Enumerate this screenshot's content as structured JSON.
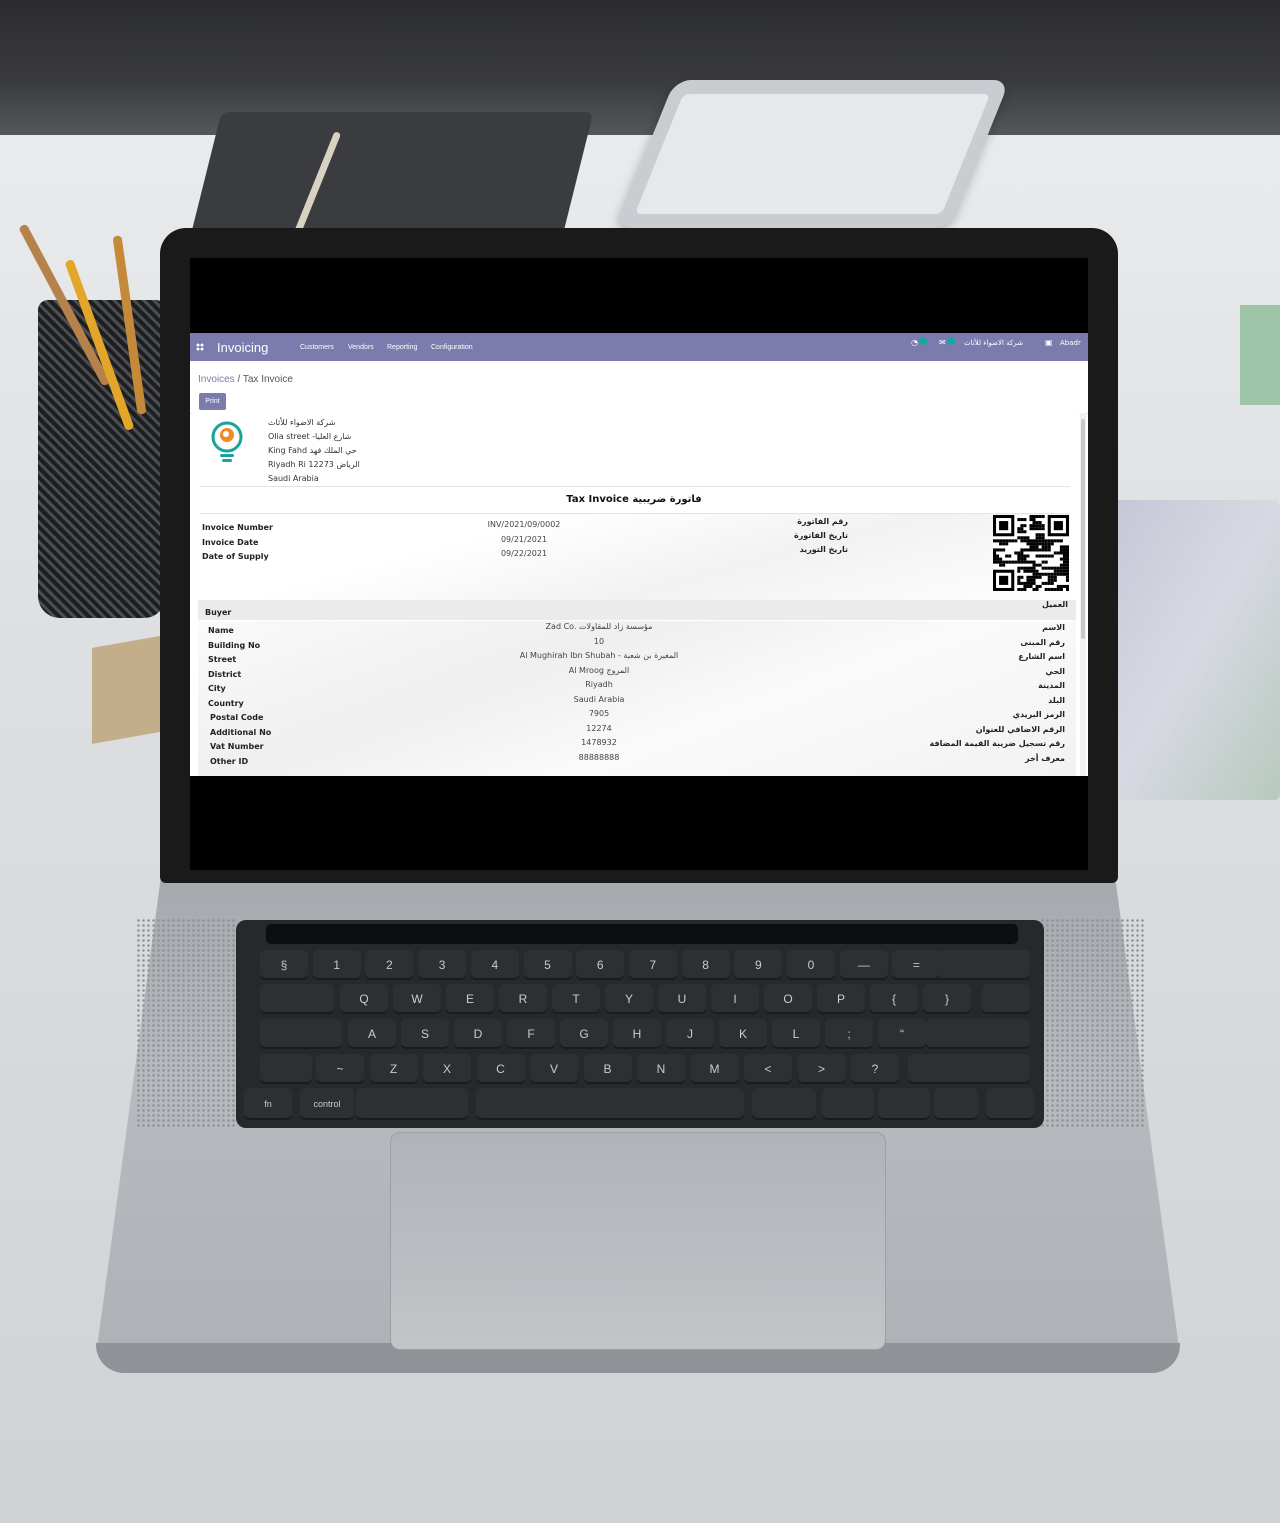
{
  "navbar": {
    "app_title": "Invoicing",
    "menu": [
      "Customers",
      "Vendors",
      "Reporting",
      "Configuration"
    ],
    "activity_count": "17",
    "messages_count": "6",
    "company": "شركة الاضواء للأثاث",
    "user": "Abadr"
  },
  "breadcrumb": {
    "parent": "Invoices",
    "separator": "/",
    "current": "Tax Invoice"
  },
  "print_label": "Print",
  "company": {
    "lines": [
      "شركة الاضواء للأثاث",
      "Olia street -شارع العليا",
      "King Fahd حي الملك فهد",
      "Riyadh Ri 12273 الرياض",
      "Saudi Arabia"
    ]
  },
  "invoice": {
    "title": "Tax Invoice فاتورة ضريبية",
    "fields": [
      {
        "label": "Invoice Number",
        "value": "INV/2021/09/0002",
        "label_ar": "رقم الفاتورة"
      },
      {
        "label": "Invoice Date",
        "value": "09/21/2021",
        "label_ar": "تاريخ الفاتورة"
      },
      {
        "label": "Date of Supply",
        "value": "09/22/2021",
        "label_ar": "تاريخ التوريد"
      }
    ]
  },
  "buyer": {
    "heading": "Buyer",
    "heading_ar": "العميل",
    "fields": [
      {
        "label": "Name",
        "value": "Zad Co. مؤسسة زاد للمقاولات",
        "label_ar": "الاسم"
      },
      {
        "label": "Building No",
        "value": "10",
        "label_ar": "رقم المبنى"
      },
      {
        "label": "Street",
        "value": "Al Mughirah Ibn Shubah - المغيرة بن شعبة",
        "label_ar": "اسم الشارع"
      },
      {
        "label": "District",
        "value": "Al Mroog المروج",
        "label_ar": "الحي"
      },
      {
        "label": "City",
        "value": "Riyadh",
        "label_ar": "المدينة"
      },
      {
        "label": "Country",
        "value": "Saudi Arabia",
        "label_ar": "البلد"
      },
      {
        "label": "Postal Code",
        "value": "7905",
        "label_ar": "الرمز البريدي"
      },
      {
        "label": "Additional No",
        "value": "12274",
        "label_ar": "الرقم الاضافي للعنوان"
      },
      {
        "label": "Vat Number",
        "value": "1478932",
        "label_ar": "رقم تسجيل ضريبة القيمة المضافة"
      },
      {
        "label": "Other ID",
        "value": "88888888",
        "label_ar": "معرف أخر"
      }
    ]
  },
  "colors": {
    "navbar": "#7c7bad",
    "accent_badge": "#16a6a0",
    "logo_teal": "#1aa39a",
    "logo_orange": "#f08a24"
  },
  "icons": [
    "apps-icon",
    "activity-icon",
    "chat-icon",
    "company-switch-icon",
    "company-logo-icon",
    "qr-code-icon"
  ],
  "keyboard": {
    "row1": [
      "§",
      "1",
      "2",
      "3",
      "4",
      "5",
      "6",
      "7",
      "8",
      "9",
      "0",
      "—",
      "="
    ],
    "row2": [
      "Q",
      "W",
      "E",
      "R",
      "T",
      "Y",
      "U",
      "I",
      "O",
      "P",
      "{",
      "}"
    ],
    "row3": [
      "A",
      "S",
      "D",
      "F",
      "G",
      "H",
      "J",
      "K",
      "L",
      ";",
      "“",
      "|"
    ],
    "row4": [
      "~",
      "Z",
      "X",
      "C",
      "V",
      "B",
      "N",
      "M",
      "<",
      ">",
      "?"
    ],
    "row5": [
      "fn",
      "control"
    ]
  }
}
